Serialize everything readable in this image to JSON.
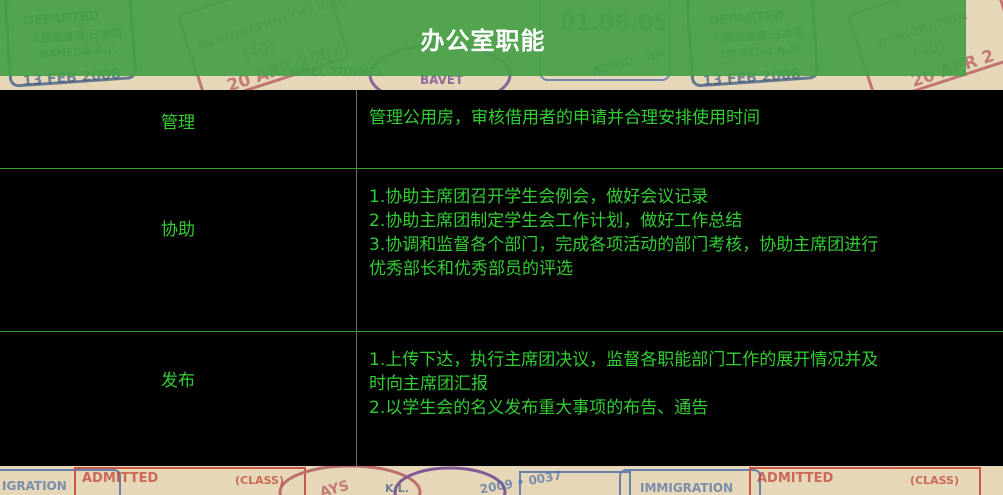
{
  "page": {
    "title": "办公室职能"
  },
  "colors": {
    "title_bg": "#46a046",
    "table_bg": "#000000",
    "text_green": "#33cc33",
    "row_border": "#2fa32f"
  },
  "duties": [
    {
      "name": "管理",
      "lines": [
        "管理公用房，审核借用者的申请并合理安排使用时间"
      ]
    },
    {
      "name": "协助",
      "lines": [
        "1.协助主席团召开学生会例会，做好会议记录",
        "2.协助主席团制定学生会工作计划，做好工作总结",
        "3.协调和监督各个部门，完成各项活动的部门考核，协助主席团进行",
        "优秀部长和优秀部员的评选"
      ]
    },
    {
      "name": "发布",
      "lines": [
        "1.上传下达，执行主席团决议，监督各职能部门工作的展开情况并及",
        "时向主席团汇报",
        "2.以学生会的名义发布重大事项的布告、通告"
      ]
    }
  ],
  "background_stamps": {
    "top": [
      "DEPARTED",
      "入国審査官·日本国",
      "HANEDA A.P.",
      "13 FEB 2006",
      "IMMIGRATION OFFICER",
      "(40)",
      "20 APR 2006",
      "NNEL TUNNEL",
      "BAVET",
      "01.06.05",
      "ADRID - BA",
      "DEPARTED",
      "入国審査官·日本国",
      "HANEDA A.P.",
      "13 FEB 2006",
      "IMMIGRATION",
      "(40)",
      "20 APR 2"
    ],
    "bottom": [
      "IGRATION",
      "ADMITTED",
      "(CLASS)",
      "AYS",
      "K.L.",
      "2009 • 0037",
      "IMMIGRATION",
      "ADMITTED",
      "(CLASS)"
    ]
  }
}
